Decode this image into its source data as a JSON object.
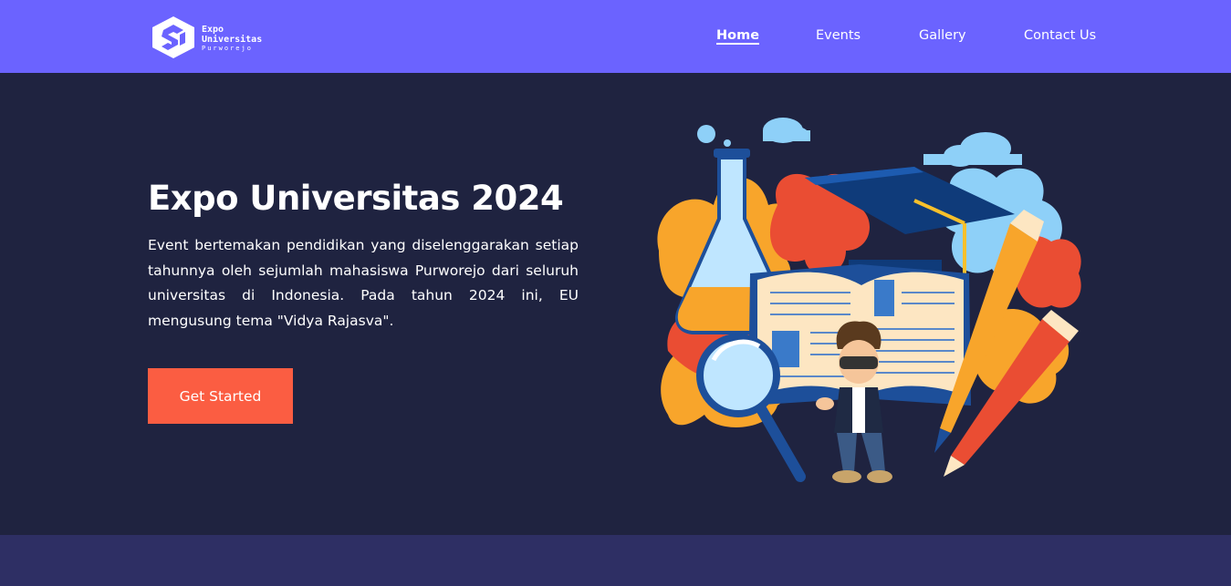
{
  "brand": {
    "name_line1": "Expo",
    "name_line2": "Universitas",
    "name_line3": "Purworejo",
    "logo_icon": "su-cube-logo"
  },
  "nav": {
    "items": [
      {
        "label": "Home",
        "active": true
      },
      {
        "label": "Events",
        "active": false
      },
      {
        "label": "Gallery",
        "active": false
      },
      {
        "label": "Contact Us",
        "active": false
      }
    ]
  },
  "hero": {
    "title": "Expo Universitas 2024",
    "description": "Event bertemakan pendidikan yang diselenggarakan setiap tahunnya oleh sejumlah mahasiswa Purworejo dari seluruh universitas di Indonesia. Pada tahun 2024 ini, EU mengusung tema \"Vidya Rajasva\".",
    "cta_label": "Get Started",
    "illustration": "education-illustration"
  },
  "colors": {
    "navbar_bg": "#6b63ff",
    "hero_bg": "#1f2340",
    "section_bg": "#2e2f64",
    "cta_bg": "#fb5d42",
    "text": "#ffffff"
  }
}
